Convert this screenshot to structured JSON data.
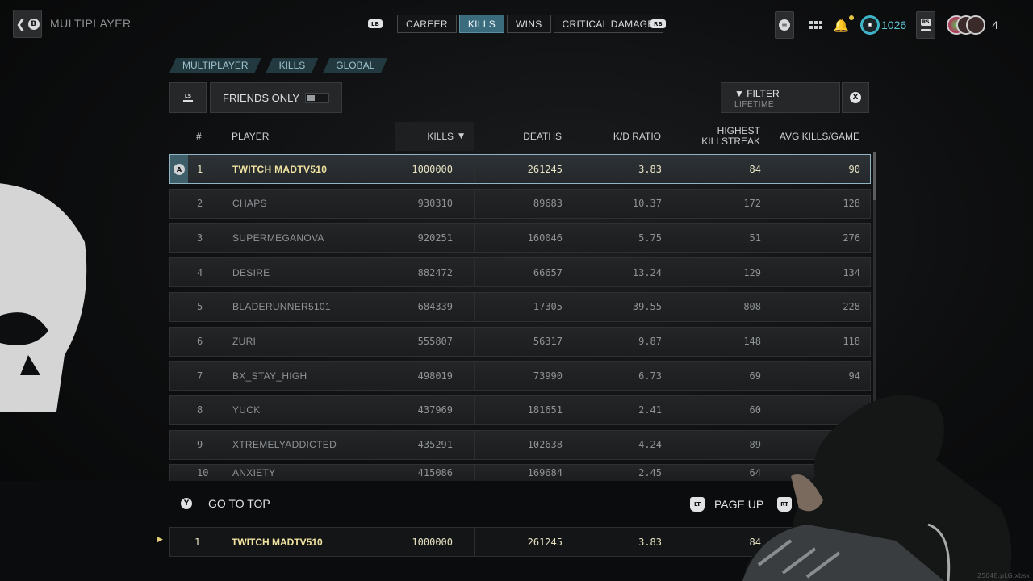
{
  "header": {
    "back_button_glyph": "B",
    "title": "MULTIPLAYER",
    "lb": "LB",
    "rb": "RB",
    "tabs": [
      {
        "label": "CAREER",
        "active": false
      },
      {
        "label": "KILLS",
        "active": true
      },
      {
        "label": "WINS",
        "active": false
      },
      {
        "label": "CRITICAL DAMAGE",
        "active": false
      }
    ],
    "rank_number": "1026",
    "rs_label": "RS",
    "party_count": "4"
  },
  "breadcrumbs": [
    "MULTIPLAYER",
    "KILLS",
    "GLOBAL"
  ],
  "controls": {
    "ls_label": "LS",
    "friends_only_label": "FRIENDS ONLY",
    "friends_only_enabled": false,
    "filter_label": "FILTER",
    "filter_value": "LIFETIME",
    "close_glyph": "X"
  },
  "table": {
    "columns": {
      "rank": "#",
      "player": "PLAYER",
      "kills": "KILLS",
      "deaths": "DEATHS",
      "kd": "K/D RATIO",
      "streak_line1": "HIGHEST",
      "streak_line2": "KILLSTREAK",
      "avg": "AVG KILLS/GAME"
    },
    "selected_badge": "A",
    "rows": [
      {
        "rank": "1",
        "player": "TWITCH MADTV510",
        "kills": "1000000",
        "deaths": "261245",
        "kd": "3.83",
        "streak": "84",
        "avg": "90"
      },
      {
        "rank": "2",
        "player": "CHAPS",
        "kills": "930310",
        "deaths": "89683",
        "kd": "10.37",
        "streak": "172",
        "avg": "128"
      },
      {
        "rank": "3",
        "player": "SUPERMEGANOVA",
        "kills": "920251",
        "deaths": "160046",
        "kd": "5.75",
        "streak": "51",
        "avg": "276"
      },
      {
        "rank": "4",
        "player": "DESIRE",
        "kills": "882472",
        "deaths": "66657",
        "kd": "13.24",
        "streak": "129",
        "avg": "134"
      },
      {
        "rank": "5",
        "player": "BLADERUNNER5101",
        "kills": "684339",
        "deaths": "17305",
        "kd": "39.55",
        "streak": "808",
        "avg": "228"
      },
      {
        "rank": "6",
        "player": "ZURI",
        "kills": "555807",
        "deaths": "56317",
        "kd": "9.87",
        "streak": "148",
        "avg": "118"
      },
      {
        "rank": "7",
        "player": "BX_STAY_HIGH",
        "kills": "498019",
        "deaths": "73990",
        "kd": "6.73",
        "streak": "69",
        "avg": "94"
      },
      {
        "rank": "8",
        "player": "YUCK",
        "kills": "437969",
        "deaths": "181651",
        "kd": "2.41",
        "streak": "60",
        "avg": ""
      },
      {
        "rank": "9",
        "player": "XTREMELYADDICTED",
        "kills": "435291",
        "deaths": "102638",
        "kd": "4.24",
        "streak": "89",
        "avg": ""
      },
      {
        "rank": "10",
        "player": "ANXIETY",
        "kills": "415086",
        "deaths": "169684",
        "kd": "2.45",
        "streak": "64",
        "avg": ""
      }
    ]
  },
  "footer": {
    "go_top_button": "Y",
    "go_top_label": "GO TO TOP",
    "lt": "LT",
    "page_up_label": "PAGE UP",
    "rt": "RT",
    "pinned": {
      "rank": "1",
      "player": "TWITCH MADTV510",
      "kills": "1000000",
      "deaths": "261245",
      "kd": "3.83",
      "streak": "84"
    }
  },
  "watermark": "25048.pLG.xbsx"
}
